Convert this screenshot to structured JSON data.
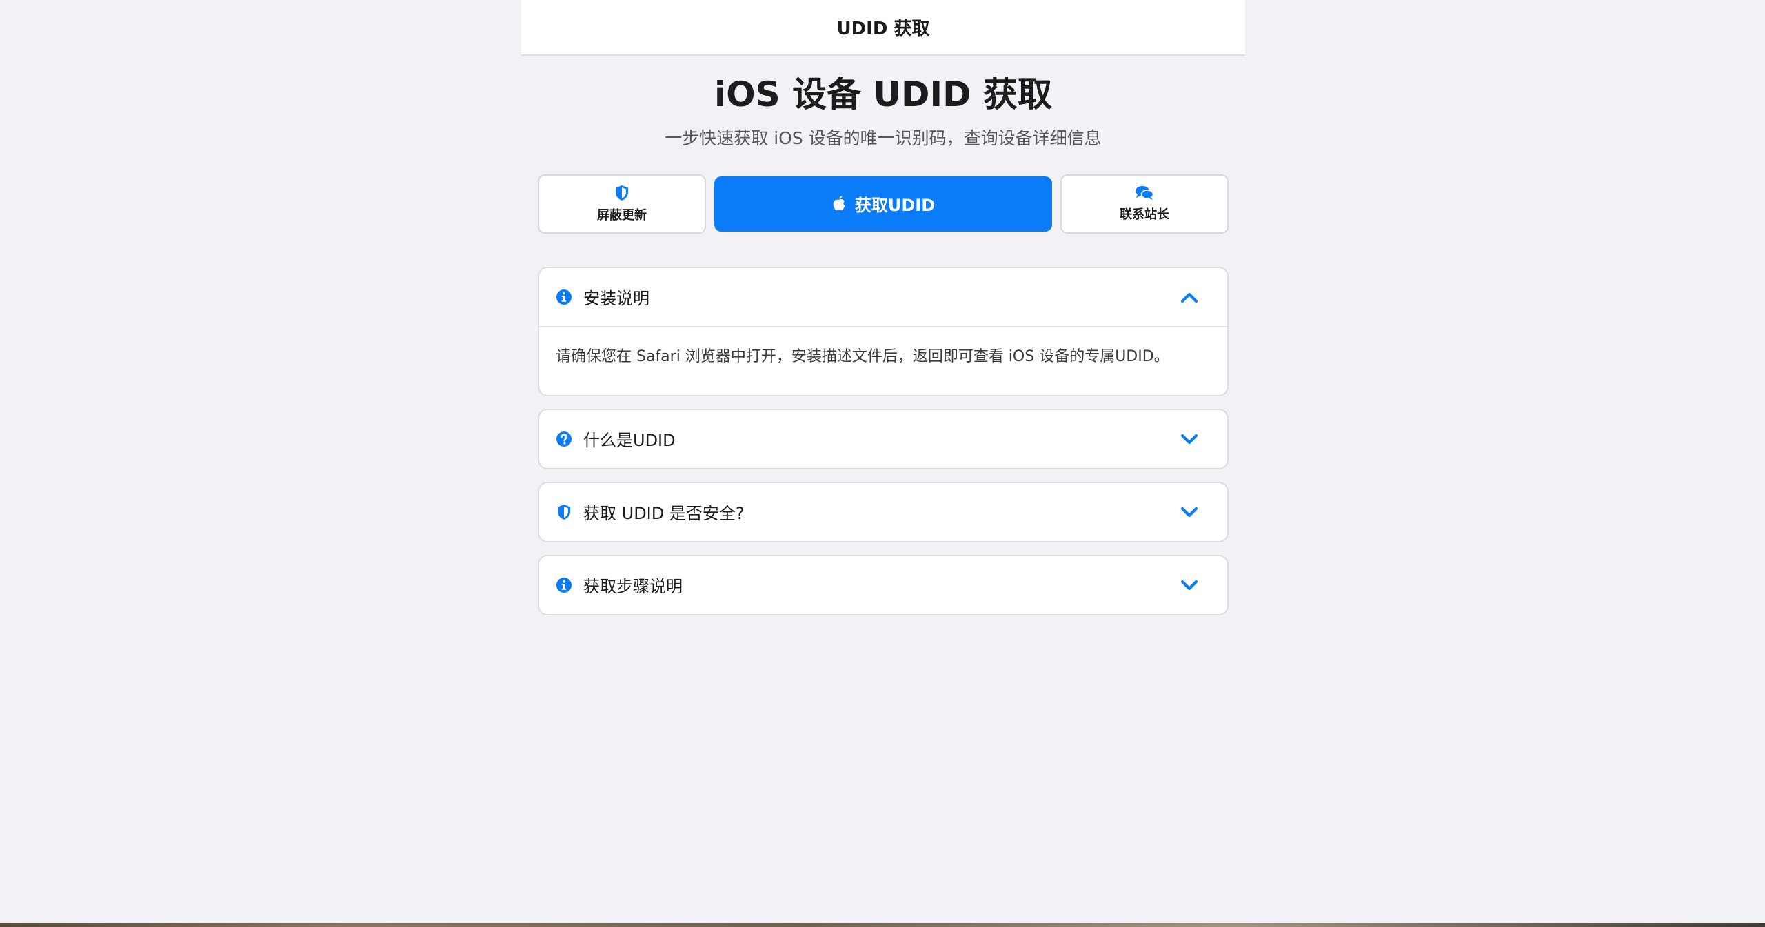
{
  "navbar": {
    "title": "UDID 获取"
  },
  "hero": {
    "title": "iOS 设备 UDID 获取",
    "subtitle": "一步快速获取 iOS 设备的唯一识别码，查询设备详细信息"
  },
  "actions": {
    "block_update": {
      "label": "屏蔽更新",
      "icon": "shield-icon"
    },
    "get_udid": {
      "label": "获取UDID",
      "icon": "apple-icon"
    },
    "contact": {
      "label": "联系站长",
      "icon": "chat-bubbles-icon"
    }
  },
  "accordions": [
    {
      "title": "安装说明",
      "icon": "info-circle-icon",
      "expanded": true,
      "body": "请确保您在 Safari 浏览器中打开，安装描述文件后，返回即可查看 iOS 设备的专属UDID。"
    },
    {
      "title": "什么是UDID",
      "icon": "question-circle-icon",
      "expanded": false
    },
    {
      "title": "获取 UDID 是否安全?",
      "icon": "shield-icon",
      "expanded": false
    },
    {
      "title": "获取步骤说明",
      "icon": "info-circle-icon",
      "expanded": false
    }
  ],
  "colors": {
    "accent": "#0a7cf7",
    "background": "#f1f1f6",
    "card": "#ffffff"
  }
}
